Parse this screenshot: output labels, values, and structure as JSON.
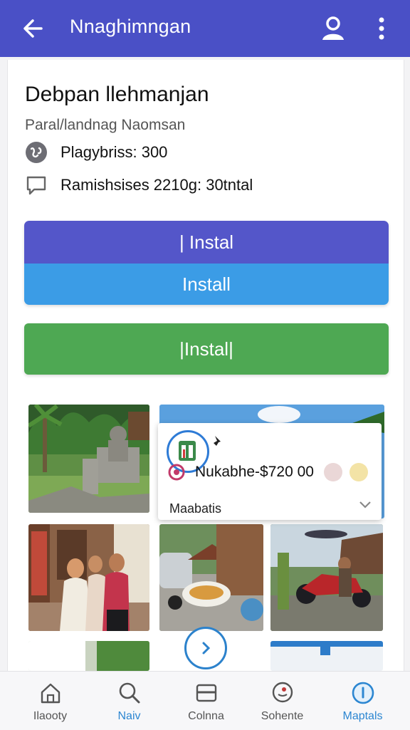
{
  "appbar": {
    "title": "Nnaghimngan",
    "back_icon": "arrow-left-icon",
    "profile_icon": "person-icon",
    "more_icon": "more-vert-icon",
    "color": "#4a50c6"
  },
  "detail": {
    "heading": "Debpan llehmanjan",
    "subtitle": "Paral/landnag Naomsan",
    "players_label": "Plagybriss: 300",
    "comments_label": "Ramishsises 2210g: 30tntal"
  },
  "buttons": {
    "install_top": "| Instal",
    "install_mid": "Install",
    "install_green": "|Instal|"
  },
  "popup": {
    "name_price": "Nukabhe-$720 00",
    "footer": "Maabatis"
  },
  "bottom_nav": [
    {
      "label": "Ilaooty",
      "icon": "home-icon"
    },
    {
      "label": "Naiv",
      "icon": "search-icon"
    },
    {
      "label": "Colnna",
      "icon": "card-icon"
    },
    {
      "label": "Sohente",
      "icon": "chat-icon"
    },
    {
      "label": "Maptals",
      "icon": "info-icon"
    }
  ],
  "colors": {
    "install_indigo": "#5456c9",
    "install_blue": "#3b9ce6",
    "install_green": "#4ea853",
    "accent": "#2c86d1"
  }
}
